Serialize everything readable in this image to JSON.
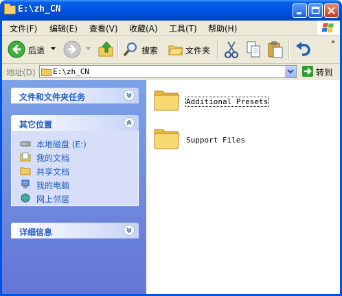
{
  "title": "E:\\zh_CN",
  "menu": [
    "文件(F)",
    "编辑(E)",
    "查看(V)",
    "收藏(A)",
    "工具(T)",
    "帮助(H)"
  ],
  "toolbar": {
    "back": "后退",
    "search": "搜索",
    "folders": "文件夹"
  },
  "address": {
    "label": "地址(D)",
    "value": "E:\\zh_CN",
    "go": "转到"
  },
  "left_pane": {
    "tasks_title": "文件和文件夹任务",
    "places_title": "其它位置",
    "places": [
      {
        "label": "本地磁盘 (E:)",
        "icon": "disk-icon"
      },
      {
        "label": "我的文档",
        "icon": "my-documents-icon"
      },
      {
        "label": "共享文档",
        "icon": "shared-documents-icon"
      },
      {
        "label": "我的电脑",
        "icon": "my-computer-icon"
      },
      {
        "label": "网上邻居",
        "icon": "network-icon"
      }
    ],
    "details_title": "详细信息"
  },
  "files": [
    {
      "name": "Additional Presets",
      "selected": true
    },
    {
      "name": "Support Files",
      "selected": false
    }
  ],
  "colors": {
    "title_blue": "#0054E3",
    "pane_link": "#215DC6",
    "pane_bg": "#7BA2E7"
  }
}
